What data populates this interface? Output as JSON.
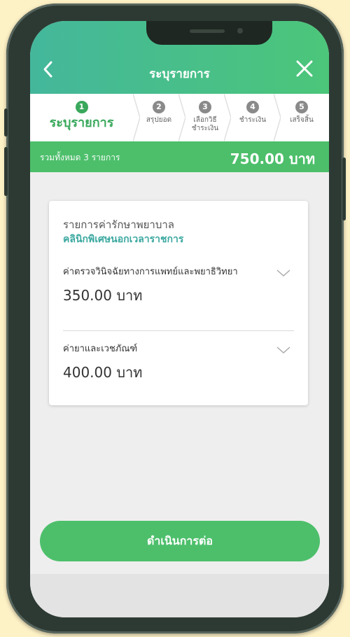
{
  "header": {
    "title": "ระบุรายการ",
    "back_icon": "chevron-left-icon",
    "close_icon": "close-icon"
  },
  "steps": [
    {
      "num": "1",
      "label": "ระบุรายการ",
      "active": true
    },
    {
      "num": "2",
      "label": "สรุปยอด",
      "active": false
    },
    {
      "num": "3",
      "label": "เลือกวิธี\nชำระเงิน",
      "active": false
    },
    {
      "num": "4",
      "label": "ชำระเงิน",
      "active": false
    },
    {
      "num": "5",
      "label": "เสร็จสิ้น",
      "active": false
    }
  ],
  "summary": {
    "label": "รวมทั้งหมด 3 รายการ",
    "amount": "750.00 บาท"
  },
  "card": {
    "title": "รายการค่ารักษาพยาบาล",
    "subtitle": "คลินิกพิเศษนอกเวลาราชการ",
    "items": [
      {
        "name": "ค่าตรวจวินิจฉัยทางการแพทย์และพยาธิวิทยา",
        "amount": "350.00 บาท"
      },
      {
        "name": "ค่ายาและเวชภัณฑ์",
        "amount": "400.00 บาท"
      }
    ]
  },
  "continue_label": "ดำเนินการต่อ",
  "colors": {
    "primary": "#4dbf6b",
    "teal": "#3aa8a0",
    "background": "#fdf1c6"
  }
}
